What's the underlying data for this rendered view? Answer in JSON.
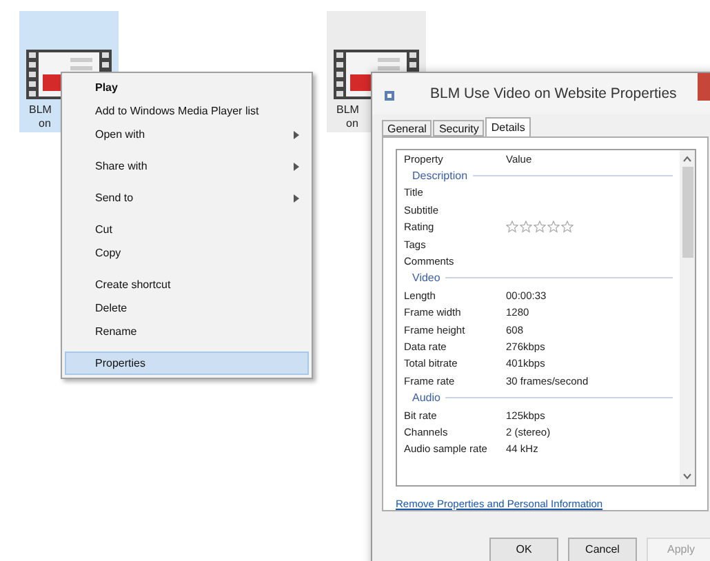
{
  "desktop_icons": [
    {
      "lines": [
        "BLM",
        "on"
      ],
      "selected": true
    },
    {
      "lines": [
        "BLM",
        "on"
      ],
      "selected": false
    }
  ],
  "context_menu": [
    {
      "label": "Play",
      "bold": true,
      "submenu": false,
      "selected": false,
      "separator_after": false
    },
    {
      "label": "Add to Windows Media Player list",
      "bold": false,
      "submenu": false,
      "selected": false,
      "separator_after": false
    },
    {
      "label": "Open with",
      "bold": false,
      "submenu": true,
      "selected": false,
      "separator_after": true
    },
    {
      "label": "Share with",
      "bold": false,
      "submenu": true,
      "selected": false,
      "separator_after": true
    },
    {
      "label": "Send to",
      "bold": false,
      "submenu": true,
      "selected": false,
      "separator_after": true
    },
    {
      "label": "Cut",
      "bold": false,
      "submenu": false,
      "selected": false,
      "separator_after": false
    },
    {
      "label": "Copy",
      "bold": false,
      "submenu": false,
      "selected": false,
      "separator_after": true
    },
    {
      "label": "Create shortcut",
      "bold": false,
      "submenu": false,
      "selected": false,
      "separator_after": false
    },
    {
      "label": "Delete",
      "bold": false,
      "submenu": false,
      "selected": false,
      "separator_after": false
    },
    {
      "label": "Rename",
      "bold": false,
      "submenu": false,
      "selected": false,
      "separator_after": true
    },
    {
      "label": "Properties",
      "bold": false,
      "submenu": false,
      "selected": true,
      "separator_after": false
    }
  ],
  "dialog": {
    "title": "BLM Use Video on Website Properties",
    "tabs": [
      {
        "label": "General",
        "selected": false
      },
      {
        "label": "Security",
        "selected": false
      },
      {
        "label": "Details",
        "selected": true
      }
    ],
    "columns": [
      "Property",
      "Value"
    ],
    "rows": [
      {
        "kind": "group",
        "label": "Description"
      },
      {
        "kind": "property",
        "name": "Title"
      },
      {
        "kind": "property",
        "name": "Subtitle"
      },
      {
        "kind": "rating",
        "name": "Rating",
        "stars": 0
      },
      {
        "kind": "property",
        "name": "Tags"
      },
      {
        "kind": "property",
        "name": "Comments"
      },
      {
        "kind": "group",
        "label": "Video"
      },
      {
        "kind": "property",
        "name": "Length",
        "value": "00:00:33"
      },
      {
        "kind": "property",
        "name": "Frame width",
        "value": "1280"
      },
      {
        "kind": "property",
        "name": "Frame height",
        "value": "608"
      },
      {
        "kind": "property",
        "name": "Data rate",
        "value": "276kbps"
      },
      {
        "kind": "property",
        "name": "Total bitrate",
        "value": "401kbps"
      },
      {
        "kind": "property",
        "name": "Frame rate",
        "value": "30 frames/second"
      },
      {
        "kind": "group",
        "label": "Audio"
      },
      {
        "kind": "property",
        "name": "Bit rate",
        "value": "125kbps"
      },
      {
        "kind": "property",
        "name": "Channels",
        "value": "2 (stereo)"
      },
      {
        "kind": "property",
        "name": "Audio sample rate",
        "value": "44 kHz"
      }
    ],
    "link": "Remove Properties and Personal Information",
    "buttons": [
      {
        "label": "OK",
        "disabled": false
      },
      {
        "label": "Cancel",
        "disabled": false
      },
      {
        "label": "Apply",
        "disabled": true
      }
    ]
  }
}
